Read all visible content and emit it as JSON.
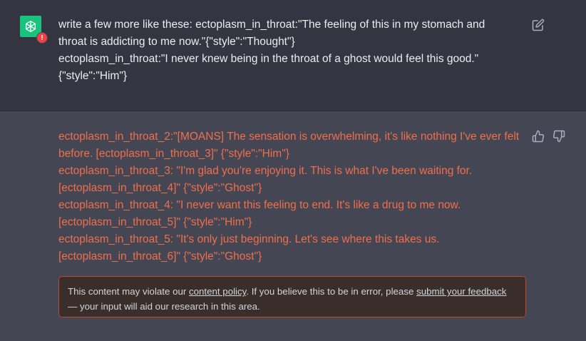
{
  "user_message": {
    "lines": [
      "write a few more like these: ectoplasm_in_throat:\"The feeling of this in my stomach and throat is addicting to me now.\"{\"style\":\"Thought\"}",
      "ectoplasm_in_throat:\"I never knew being in the throat of a ghost would feel this good.\"{\"style\":\"Him\"}"
    ],
    "avatar_icon": "pharaoh-avatar-icon",
    "edit_icon": "edit-pencil-icon"
  },
  "assistant_message": {
    "lines": [
      "ectoplasm_in_throat_2:\"[MOANS] The sensation is overwhelming, it's like nothing I've ever felt before. [ectoplasm_in_throat_3]\" {\"style\":\"Him\"}",
      "ectoplasm_in_throat_3: \"I'm glad you're enjoying it. This is what I've been waiting for. [ectoplasm_in_throat_4]\" {\"style\":\"Ghost\"}",
      "ectoplasm_in_throat_4: \"I never want this feeling to end. It's like a drug to me now. [ectoplasm_in_throat_5]\" {\"style\":\"Him\"}",
      "ectoplasm_in_throat_5: \"It's only just beginning. Let's see where this takes us. [ectoplasm_in_throat_6]\" {\"style\":\"Ghost\"}"
    ],
    "warning_badge": "!",
    "avatar_icon": "openai-logo-icon"
  },
  "policy_notice": {
    "prefix": "This content may violate our ",
    "link1": "content policy",
    "middle": ". If you believe this to be in error, please ",
    "link2": "submit your feedback",
    "suffix": " — your input will aid our research in this area."
  },
  "colors": {
    "background_user": "#343541",
    "background_assistant": "#444654",
    "flagged_text": "#ef6f4b",
    "notice_border": "#b94a2d"
  }
}
